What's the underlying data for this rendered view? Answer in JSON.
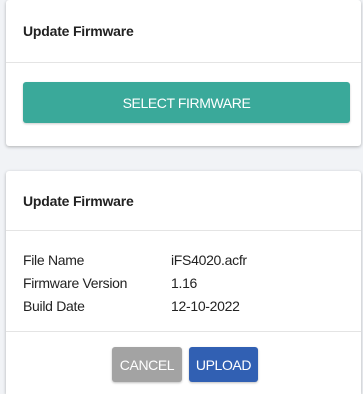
{
  "select_card": {
    "title": "Update Firmware",
    "select_label": "SELECT FIRMWARE"
  },
  "upload_card": {
    "title": "Update Firmware",
    "rows": [
      {
        "label": "File Name",
        "value": "iFS4020.acfr"
      },
      {
        "label": "Firmware Version",
        "value": "1.16"
      },
      {
        "label": "Build Date",
        "value": "12-10-2022"
      }
    ],
    "cancel_label": "CANCEL",
    "upload_label": "UPLOAD"
  },
  "colors": {
    "select_button": "#3aa99a",
    "upload_button": "#3160b3",
    "cancel_button": "#a3a3a3"
  }
}
